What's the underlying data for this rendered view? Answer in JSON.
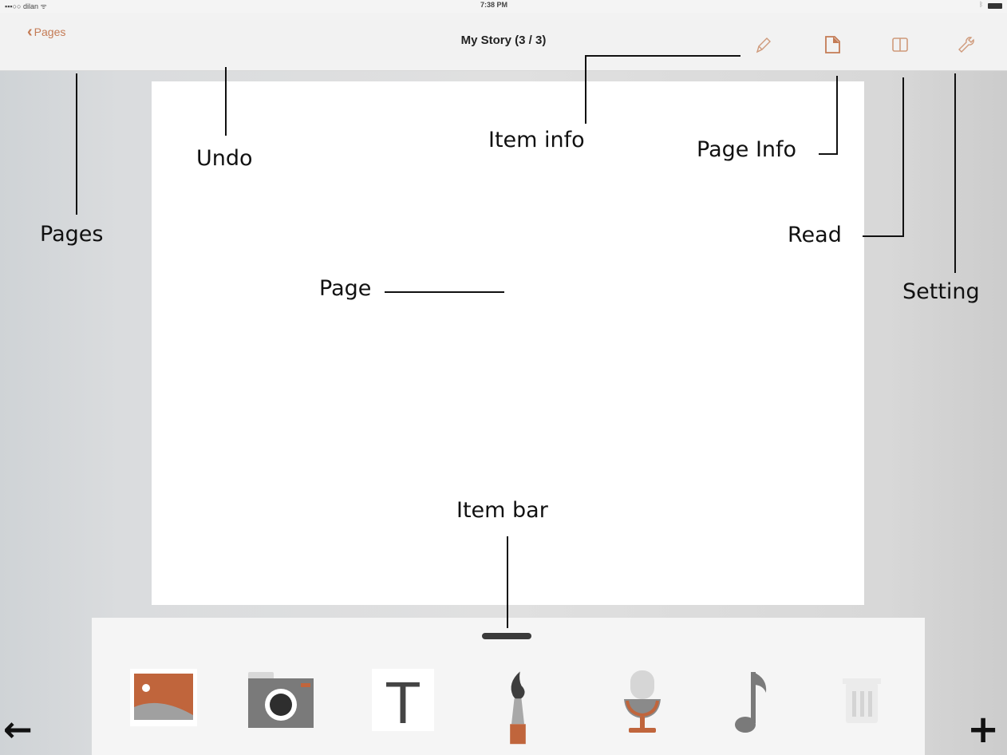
{
  "status_bar": {
    "carrier": "▪▪▪○○ dilan ᯤ",
    "time": "7:38 PM"
  },
  "nav": {
    "back_label": "Pages",
    "title": "My Story (3 / 3)",
    "icons": [
      "pen-icon",
      "page-icon",
      "book-icon",
      "wrench-icon"
    ]
  },
  "annotations": {
    "pages": "Pages",
    "undo": "Undo",
    "item_info": "Item info",
    "page_info": "Page Info",
    "read": "Read",
    "setting": "Setting",
    "page": "Page",
    "item_bar": "Item bar"
  },
  "item_bar": {
    "tools": [
      "photo-icon",
      "camera-icon",
      "text-icon",
      "brush-icon",
      "microphone-icon",
      "music-note-icon",
      "trash-icon"
    ],
    "text_tool_glyph": "T"
  },
  "bottom": {
    "prev_glyph": "←",
    "add_glyph": "+"
  },
  "colors": {
    "accent": "#c47b55",
    "accent_dark": "#c0653c",
    "icon_gray": "#7a7a7a"
  }
}
